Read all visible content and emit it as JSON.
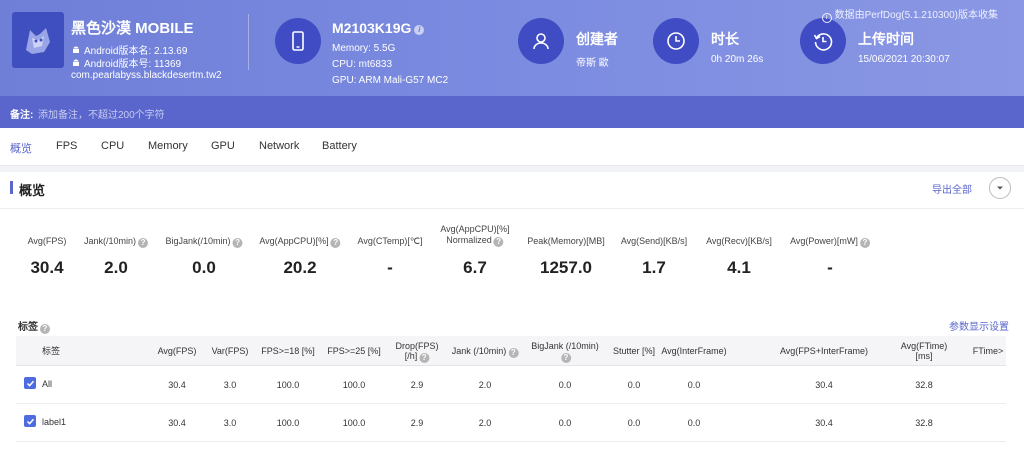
{
  "app": {
    "name": "黑色沙漠 MOBILE",
    "version_label": "Android版本名: 2.13.69",
    "code_label": "Android版本号: 11369",
    "package": "com.pearlabyss.blackdesertm.tw2"
  },
  "device": {
    "model": "M2103K19G",
    "memory": "Memory: 5.5G",
    "cpu": "CPU: mt6833",
    "gpu": "GPU: ARM Mali-G57 MC2"
  },
  "creator": {
    "title": "创建者",
    "value": "帝斯 歐"
  },
  "duration": {
    "title": "时长",
    "value": "0h 20m 26s"
  },
  "upload": {
    "title": "上传时间",
    "value": "15/06/2021 20:30:07"
  },
  "source_note": "数据由PerfDog(5.1.210300)版本收集",
  "note": {
    "label": "备注:",
    "placeholder": "添加备注，不超过200个字符"
  },
  "tabs": [
    "概览",
    "FPS",
    "CPU",
    "Memory",
    "GPU",
    "Network",
    "Battery"
  ],
  "active_tab": "概览",
  "overview": {
    "title": "概览",
    "export_label": "导出全部",
    "metrics": [
      {
        "label": "Avg(FPS)",
        "label2": "",
        "value": "30.4",
        "help": false
      },
      {
        "label": "Jank(/10min)",
        "label2": "",
        "value": "2.0",
        "help": true
      },
      {
        "label": "BigJank(/10min)",
        "label2": "",
        "value": "0.0",
        "help": true
      },
      {
        "label": "Avg(AppCPU)[%]",
        "label2": "",
        "value": "20.2",
        "help": true
      },
      {
        "label": "Avg(CTemp)[℃]",
        "label2": "",
        "value": "-",
        "help": false
      },
      {
        "label": "Avg(AppCPU)[%]",
        "label2": "Normalized",
        "value": "6.7",
        "help": true
      },
      {
        "label": "Peak(Memory)[MB]",
        "label2": "",
        "value": "1257.0",
        "help": false
      },
      {
        "label": "Avg(Send)[KB/s]",
        "label2": "",
        "value": "1.7",
        "help": false
      },
      {
        "label": "Avg(Recv)[KB/s]",
        "label2": "",
        "value": "4.1",
        "help": false
      },
      {
        "label": "Avg(Power)[mW]",
        "label2": "",
        "value": "-",
        "help": true
      }
    ]
  },
  "tags": {
    "title": "标签",
    "param_link": "参数显示设置",
    "columns": [
      {
        "label": "标签",
        "label2": "",
        "help": false
      },
      {
        "label": "Avg(FPS)",
        "label2": "",
        "help": false
      },
      {
        "label": "Var(FPS)",
        "label2": "",
        "help": false
      },
      {
        "label": "FPS>=18 [%]",
        "label2": "",
        "help": false
      },
      {
        "label": "FPS>=25 [%]",
        "label2": "",
        "help": false
      },
      {
        "label": "Drop(FPS)",
        "label2": "[/h]",
        "help": true
      },
      {
        "label": "Jank (/10min)",
        "label2": "",
        "help": true
      },
      {
        "label": "BigJank (/10min)",
        "label2": "",
        "help": true
      },
      {
        "label": "Stutter [%]",
        "label2": "",
        "help": false
      },
      {
        "label": "Avg(InterFrame)",
        "label2": "",
        "help": false
      },
      {
        "label": "Avg(FPS+InterFrame)",
        "label2": "",
        "help": false
      },
      {
        "label": "Avg(FTime)",
        "label2": "[ms]",
        "help": false
      },
      {
        "label": "FTime>",
        "label2": "",
        "help": false
      }
    ],
    "rows": [
      {
        "name": "All",
        "checked": true,
        "cells": [
          "30.4",
          "3.0",
          "100.0",
          "100.0",
          "2.9",
          "2.0",
          "0.0",
          "0.0",
          "0.0",
          "30.4",
          "32.8"
        ]
      },
      {
        "name": "label1",
        "checked": true,
        "cells": [
          "30.4",
          "3.0",
          "100.0",
          "100.0",
          "2.9",
          "2.0",
          "0.0",
          "0.0",
          "0.0",
          "30.4",
          "32.8"
        ]
      }
    ]
  }
}
